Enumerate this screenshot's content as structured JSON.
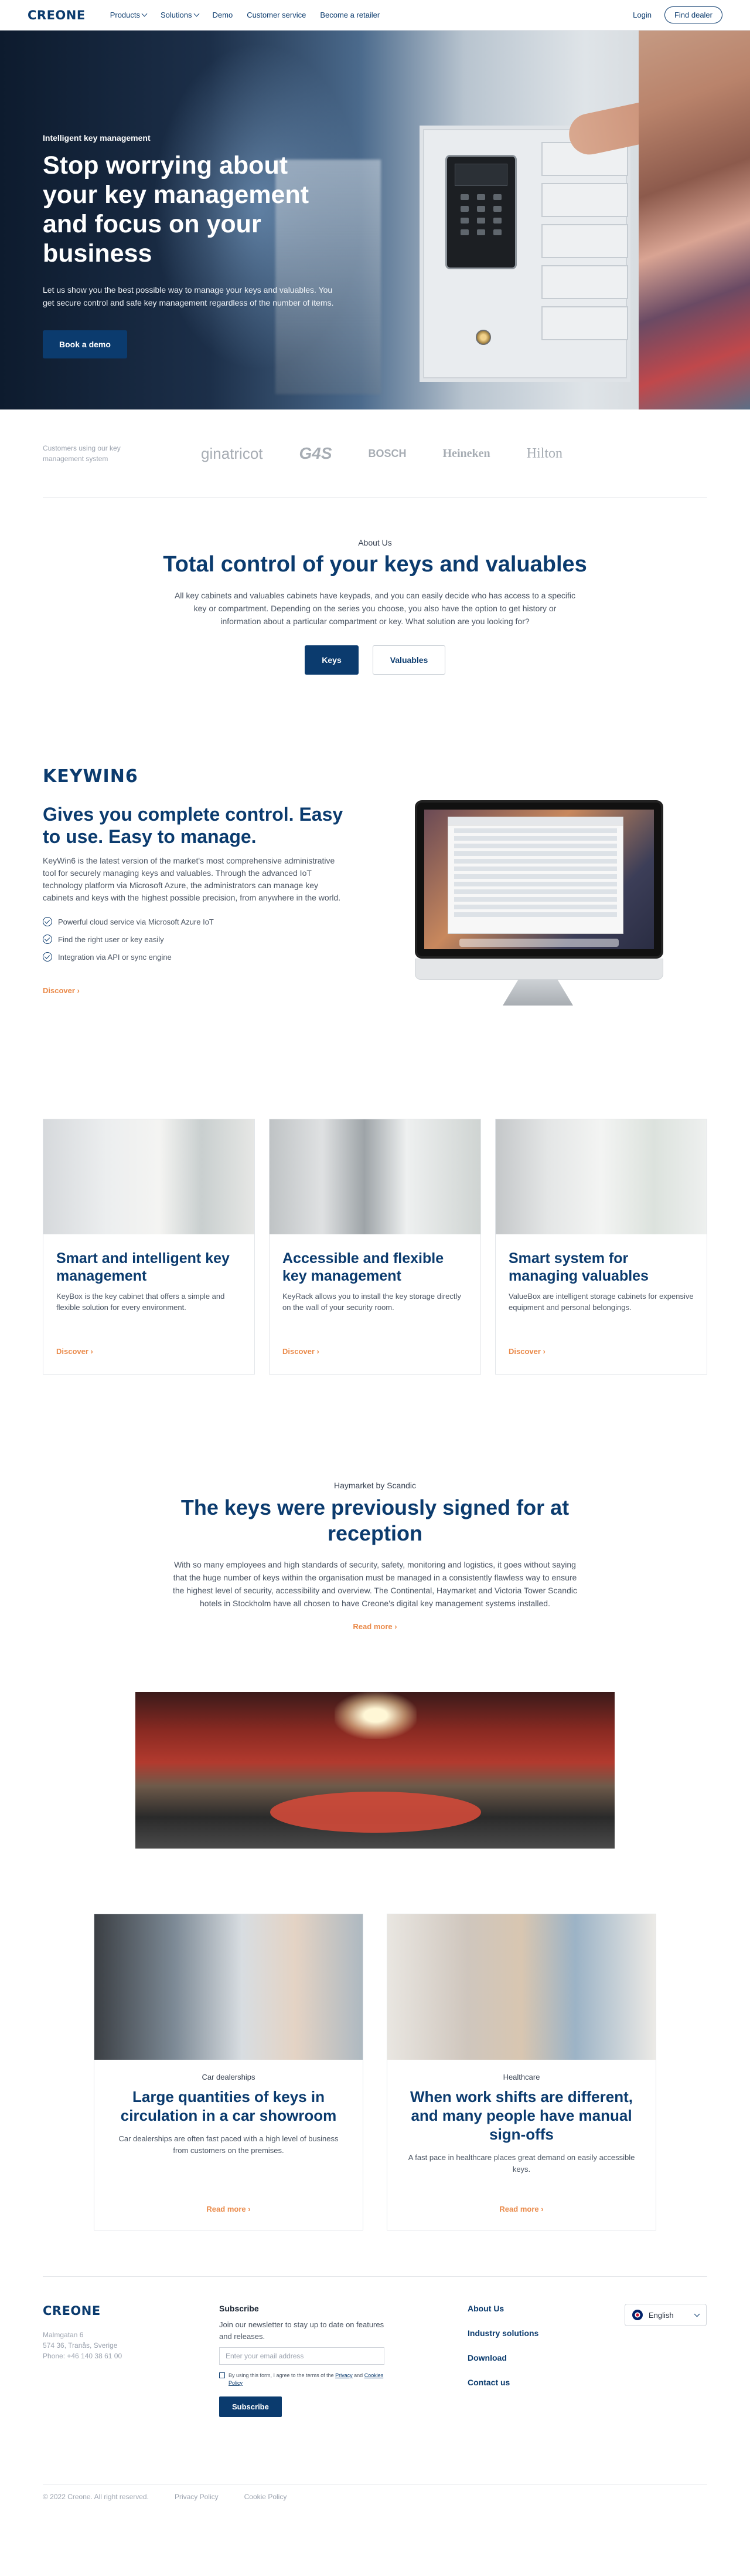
{
  "nav": {
    "logo": "CREONE",
    "items": [
      "Products",
      "Solutions",
      "Demo",
      "Customer service",
      "Become a retailer"
    ],
    "login": "Login",
    "find_dealer": "Find dealer"
  },
  "hero": {
    "eyebrow": "Intelligent key management",
    "title": "Stop worrying about your key management and focus on your business",
    "text": "Let us show you the best possible way to manage your keys and valuables. You get secure control and safe key management regardless of the number of items.",
    "cta": "Book a demo"
  },
  "customers": {
    "label": "Customers using our key management system",
    "brands": [
      "ginatricot",
      "G4S",
      "BOSCH",
      "Heineken",
      "Hilton"
    ]
  },
  "about": {
    "eyebrow": "About Us",
    "title": "Total control of your keys and valuables",
    "text": "All key cabinets and valuables cabinets have keypads, and you can easily decide who has access to a specific key or compartment. Depending on the series you choose, you also have the option to get history or information about a particular compartment or key. What solution are you looking for?",
    "tabs": [
      "Keys",
      "Valuables"
    ]
  },
  "keywin": {
    "logo": "KEYWIN6",
    "title": "Gives you complete control. Easy to use. Easy to manage.",
    "text": "KeyWin6 is the latest version of the market's most comprehensive administrative tool for securely managing keys and valuables. Through the advanced IoT technology platform via Microsoft Azure, the administrators can manage key cabinets and keys with the highest possible precision, from anywhere in the world.",
    "checks": [
      "Powerful cloud service via Microsoft Azure IoT",
      "Find the right user or key easily",
      "Integration via API or sync engine"
    ],
    "discover": "Discover"
  },
  "products": [
    {
      "title": "Smart and intelligent key management",
      "text": "KeyBox is the key cabinet that offers a simple and flexible solution for every environment.",
      "link": "Discover"
    },
    {
      "title": "Accessible and flexible key management",
      "text": "KeyRack allows you to install the key storage directly on the wall of your security room.",
      "link": "Discover"
    },
    {
      "title": "Smart system for managing valuables",
      "text": "ValueBox are intelligent storage cabinets for expensive equipment and personal belongings.",
      "link": "Discover"
    }
  ],
  "case": {
    "eyebrow": "Haymarket by Scandic",
    "title": "The keys were previously signed for at reception",
    "text": "With so many employees and high standards of security, safety, monitoring and logistics, it goes without saying that the huge number of keys within the organisation must be managed in a consistently flawless way to ensure the highest level of security, accessibility and overview. The Continental, Haymarket and Victoria Tower Scandic hotels in Stockholm have all chosen to have Creone's digital key management systems installed.",
    "link": "Read more"
  },
  "industries": [
    {
      "category": "Car dealerships",
      "title": "Large quantities of keys in circulation in a car showroom",
      "text": "Car dealerships are often fast paced with a high level of business from customers on the premises.",
      "link": "Read more"
    },
    {
      "category": "Healthcare",
      "title": "When work shifts are different, and many people have manual sign-offs",
      "text": "A fast pace in healthcare places great demand on easily accessible keys.",
      "link": "Read more"
    }
  ],
  "footer": {
    "logo": "CREONE",
    "address": [
      "Malmgatan 6",
      "574 36, Tranås, Sverige",
      "Phone: +46 140 38 61 00"
    ],
    "subscribe_title": "Subscribe",
    "subscribe_text": "Join our newsletter to stay up to date on features and releases.",
    "email_placeholder": "Enter your email address",
    "consent_prefix": "By using this form, I agree to the terms of the",
    "consent_link1": "Privacy",
    "consent_and": "and",
    "consent_link2": "Cookies Policy",
    "subscribe_button": "Subscribe",
    "links": [
      "About Us",
      "Industry solutions",
      "Download",
      "Contact us"
    ],
    "language": "English",
    "copyright": "© 2022 Creone. All right reserved.",
    "privacy": "Privacy Policy",
    "cookies": "Cookie Policy"
  },
  "colors": {
    "brand": "#0b3b6e",
    "accent": "#ea8a4a"
  }
}
